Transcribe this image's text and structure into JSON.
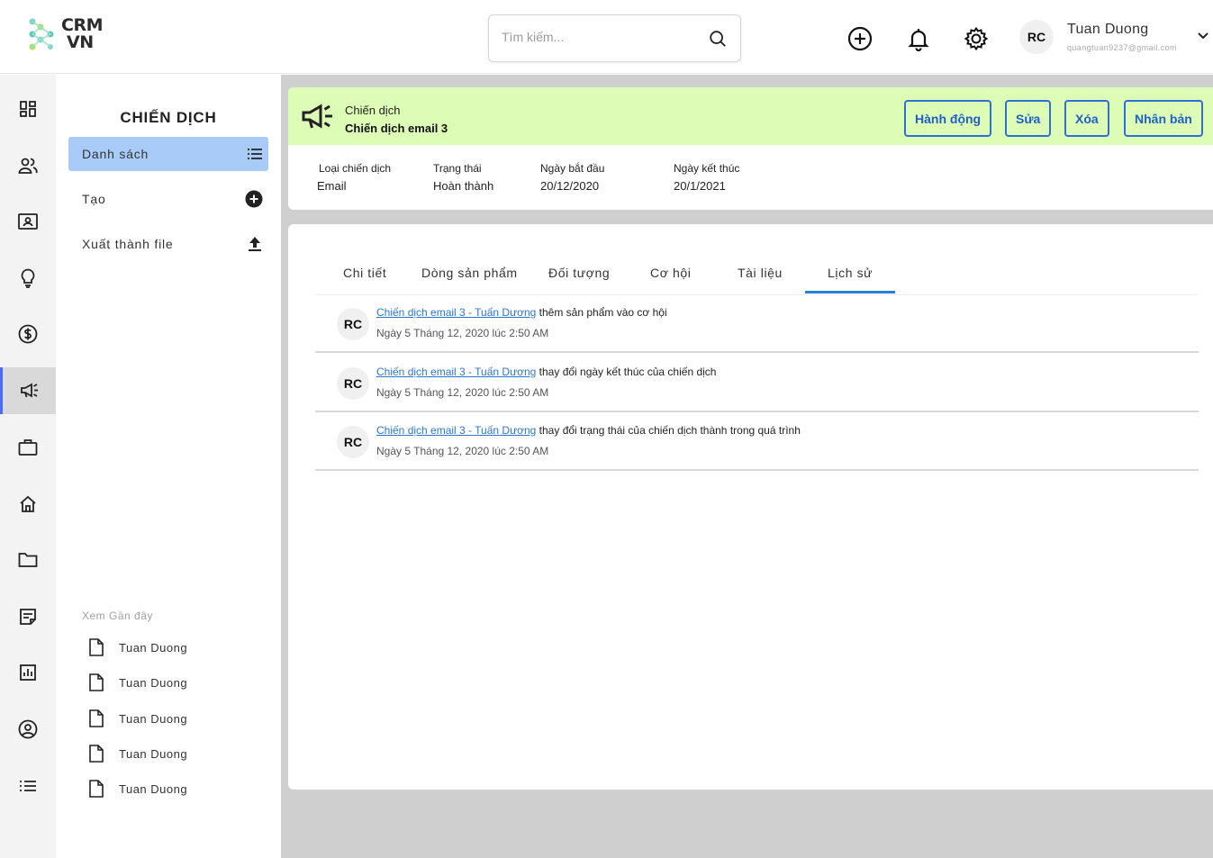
{
  "header": {
    "logo_line1": "CRM",
    "logo_line2": "VN",
    "search_placeholder": "Tìm kiếm...",
    "user_initials": "RC",
    "user_name": "Tuan Duong",
    "user_email": "quangtuan9237@gmail.com"
  },
  "rail": {
    "icons": [
      "dashboard-icon",
      "contacts-icon",
      "contact-card-icon",
      "lightbulb-icon",
      "dollar-icon",
      "megaphone-icon",
      "briefcase-icon",
      "home-icon",
      "folder-icon",
      "note-icon",
      "chart-icon",
      "user-circle-icon",
      "list-icon"
    ],
    "active_index": 5
  },
  "sidebar": {
    "title": "CHIẾN DỊCH",
    "items": [
      {
        "label": "Danh sách",
        "icon": "list-icon"
      },
      {
        "label": "Tạo",
        "icon": "add-circle-icon"
      },
      {
        "label": "Xuất thành file",
        "icon": "upload-icon"
      }
    ],
    "recent_title": "Xem Gần đây",
    "recent": [
      "Tuan Duong",
      "Tuan Duong",
      "Tuan Duong",
      "Tuan Duong",
      "Tuan Duong"
    ]
  },
  "campaign": {
    "label": "Chiến dịch",
    "name": "Chiến dịch email 3",
    "actions": [
      "Hành động",
      "Sửa",
      "Xóa",
      "Nhân bản"
    ],
    "info": [
      {
        "label": "Loại chiến dịch",
        "value": "Email"
      },
      {
        "label": "Trạng thái",
        "value": "Hoàn thành"
      },
      {
        "label": "Ngày bắt đầu",
        "value": "20/12/2020"
      },
      {
        "label": "Ngày kết thúc",
        "value": "20/1/2021"
      }
    ]
  },
  "tabs": [
    "Chi tiết",
    "Dòng sản phẩm",
    "Đối tượng",
    "Cơ hội",
    "Tài liệu",
    "Lịch sử"
  ],
  "active_tab": "Lịch sử",
  "history": [
    {
      "initials": "RC",
      "link": "Chiến dịch email 3 - Tuấn Dương",
      "action": "thêm sản phẩm vào cơ hội",
      "time": "Ngày 5 Tháng 12, 2020 lúc 2:50 AM"
    },
    {
      "initials": "RC",
      "link": "Chiến dịch email 3 - Tuấn Dương",
      "action": "thay đổi ngày kết thúc của chiến dịch",
      "time": "Ngày 5 Tháng 12, 2020 lúc 2:50 AM"
    },
    {
      "initials": "RC",
      "link": "Chiến dịch email 3 - Tuấn Dương",
      "action": "thay đổi trạng thái của chiến dịch thành trong quá trình",
      "time": "Ngày 5 Tháng 12, 2020 lúc 2:50 AM"
    }
  ],
  "colors": {
    "banner": "#ddfcb5",
    "accent": "#2f6fd6",
    "active_item": "#a8ccf7",
    "link": "#2b77d4"
  }
}
